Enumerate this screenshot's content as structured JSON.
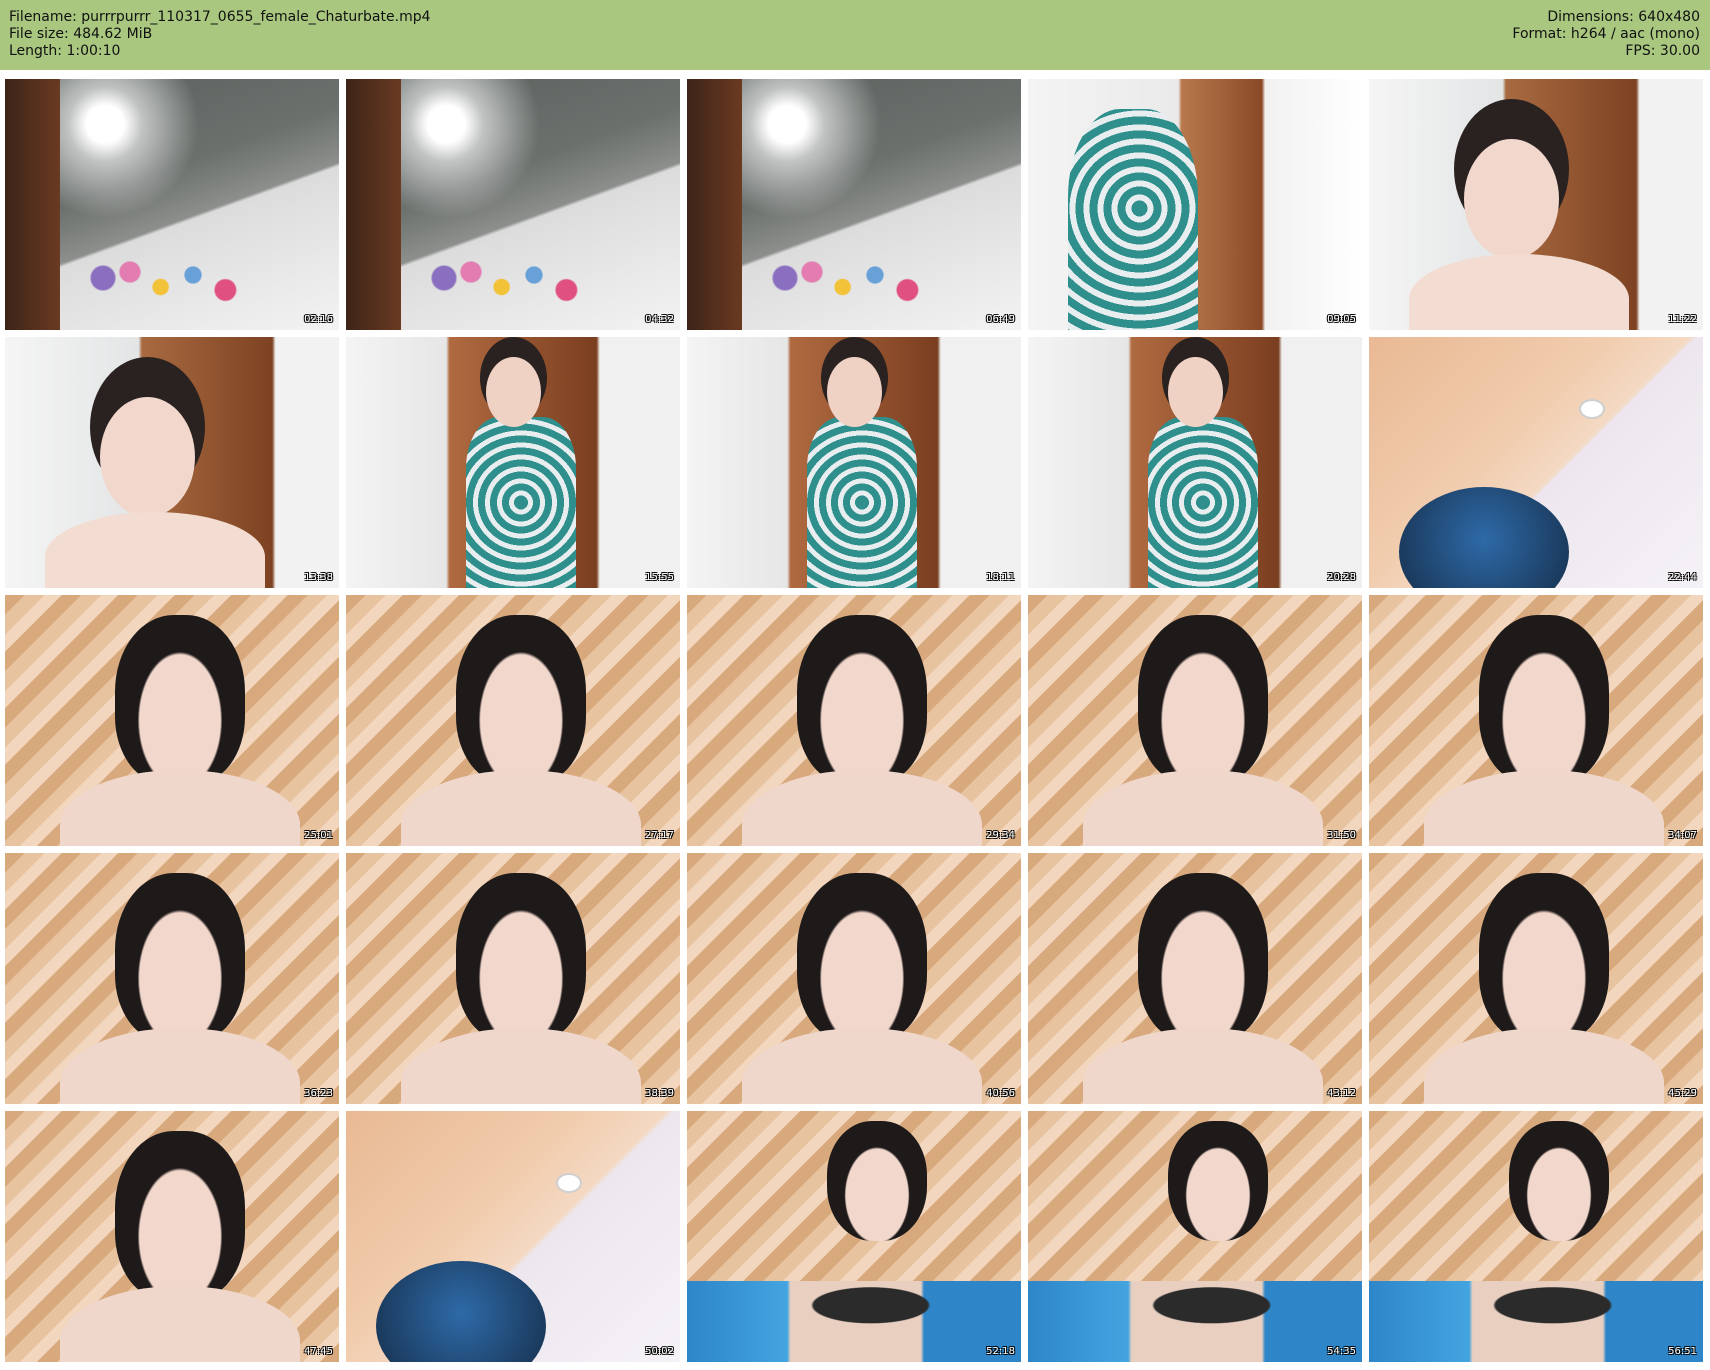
{
  "header": {
    "filename": "Filename: purrrpurrr_110317_0655_female_Chaturbate.mp4",
    "filesize": "File size: 484.62 MiB",
    "length": "Length: 1:00:10",
    "dimensions": "Dimensions: 640x480",
    "format": "Format: h264 / aac (mono)",
    "fps": "FPS: 30.00"
  },
  "colors": {
    "header_bg": "#a9c77f",
    "page_bg": "#ffffff"
  },
  "thumbnails": [
    {
      "time": "02:16"
    },
    {
      "time": "04:32"
    },
    {
      "time": "06:49"
    },
    {
      "time": "09:05"
    },
    {
      "time": "11:22"
    },
    {
      "time": "13:38"
    },
    {
      "time": "15:55"
    },
    {
      "time": "18:11"
    },
    {
      "time": "20:28"
    },
    {
      "time": "22:44"
    },
    {
      "time": "25:01"
    },
    {
      "time": "27:17"
    },
    {
      "time": "29:34"
    },
    {
      "time": "31:50"
    },
    {
      "time": "34:07"
    },
    {
      "time": "36:23"
    },
    {
      "time": "38:39"
    },
    {
      "time": "40:56"
    },
    {
      "time": "43:12"
    },
    {
      "time": "45:29"
    },
    {
      "time": "47:45"
    },
    {
      "time": "50:02"
    },
    {
      "time": "52:18"
    },
    {
      "time": "54:35"
    },
    {
      "time": "56:51"
    }
  ]
}
